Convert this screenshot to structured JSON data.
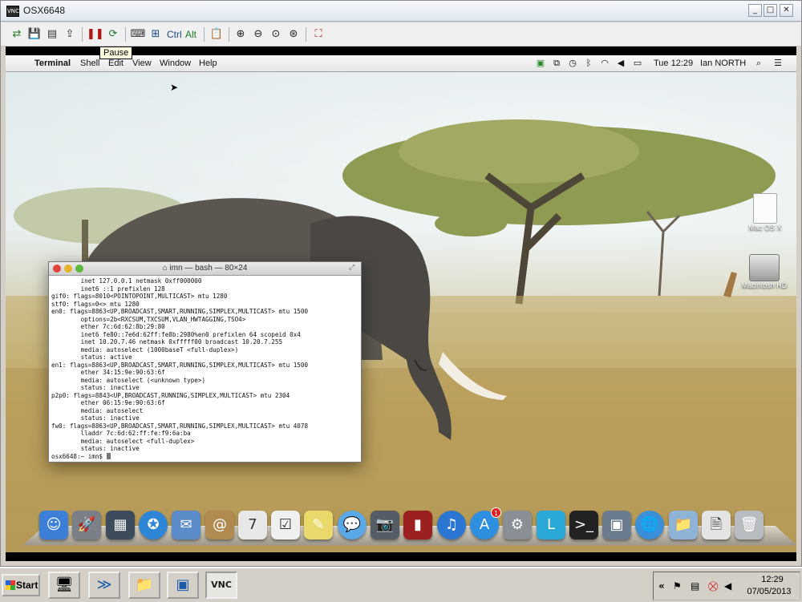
{
  "vnc": {
    "title": "OSX6648",
    "min": "_",
    "max": "□",
    "close": "✕",
    "toolbar": {
      "ctrl": "Ctrl",
      "alt": "Alt"
    },
    "tooltip": "Pause"
  },
  "mac_menubar": {
    "apple": "",
    "app": "Terminal",
    "items": [
      "Shell",
      "Edit",
      "View",
      "Window",
      "Help"
    ],
    "clock": "Tue 12:29",
    "user": "Ian NORTH",
    "spotlight": "⌕",
    "list": "☰"
  },
  "terminal": {
    "title": "⌂ imn — bash — 80×24",
    "lines": [
      "        inet 127.0.0.1 netmask 0xff000000",
      "        inet6 ::1 prefixlen 128",
      "gif0: flags=8010<POINTOPOINT,MULTICAST> mtu 1280",
      "stf0: flags=0<> mtu 1280",
      "en0: flags=8863<UP,BROADCAST,SMART,RUNNING,SIMPLEX,MULTICAST> mtu 1500",
      "        options=2b<RXCSUM,TXCSUM,VLAN_HWTAGGING,TSO4>",
      "        ether 7c:6d:62:8b:29:80",
      "        inet6 fe80::7e6d:62ff:fe8b:2980%en0 prefixlen 64 scopeid 0x4",
      "        inet 10.20.7.46 netmask 0xfffff00 broadcast 10.20.7.255",
      "        media: autoselect (1000baseT <full-duplex>)",
      "        status: active",
      "en1: flags=8863<UP,BROADCAST,SMART,RUNNING,SIMPLEX,MULTICAST> mtu 1500",
      "        ether 34:15:9e:90:63:6f",
      "        media: autoselect (<unknown type>)",
      "        status: inactive",
      "p2p0: flags=8843<UP,BROADCAST,RUNNING,SIMPLEX,MULTICAST> mtu 2304",
      "        ether 06:15:9e:90:63:6f",
      "        media: autoselect",
      "        status: inactive",
      "fw0: flags=8863<UP,BROADCAST,SMART,RUNNING,SIMPLEX,MULTICAST> mtu 4078",
      "        lladdr 7c:6d:62:ff:fe:f9:6a:ba",
      "        media: autoselect <full-duplex>",
      "        status: inactive"
    ],
    "prompt": "osx6648:~ imn$ "
  },
  "desktop": {
    "icons": [
      {
        "label": "Mac OS X",
        "glyph": "🗋"
      },
      {
        "label": "Macintosh HD",
        "glyph": "🖴"
      }
    ]
  },
  "dock": {
    "items": [
      {
        "name": "finder",
        "glyph": "☺",
        "color": "#3b7fd9"
      },
      {
        "name": "launchpad",
        "glyph": "🚀",
        "color": "#7a7f88"
      },
      {
        "name": "mission-control",
        "glyph": "▦",
        "color": "#3c4c5c"
      },
      {
        "name": "safari",
        "glyph": "✪",
        "color": "#2f86d6"
      },
      {
        "name": "mail",
        "glyph": "✉",
        "color": "#5b8bc8"
      },
      {
        "name": "contacts",
        "glyph": "@",
        "color": "#b08a4e"
      },
      {
        "name": "calendar",
        "glyph": "7",
        "color": "#e8e8e8"
      },
      {
        "name": "reminders",
        "glyph": "☑",
        "color": "#f0f0f0"
      },
      {
        "name": "notes",
        "glyph": "✎",
        "color": "#e9d96a"
      },
      {
        "name": "messages",
        "glyph": "💬",
        "color": "#5aa8e8"
      },
      {
        "name": "facetime",
        "glyph": "📷",
        "color": "#555c66"
      },
      {
        "name": "photo-booth",
        "glyph": "▮",
        "color": "#9c2020"
      },
      {
        "name": "itunes",
        "glyph": "♫",
        "color": "#2a76d2"
      },
      {
        "name": "app-store",
        "glyph": "A",
        "color": "#2e8ee0"
      },
      {
        "name": "system-preferences",
        "glyph": "⚙",
        "color": "#8a8f96"
      },
      {
        "name": "lync",
        "glyph": "L",
        "color": "#2aa8d8"
      },
      {
        "name": "terminal",
        "glyph": ">_",
        "color": "#222222"
      },
      {
        "name": "remote-desktop",
        "glyph": "▣",
        "color": "#6a7c8e"
      },
      {
        "name": "network-utility",
        "glyph": "🌐",
        "color": "#3a8fd9"
      },
      {
        "name": "documents-stack",
        "glyph": "📁",
        "color": "#8fb3d6"
      },
      {
        "name": "downloads-stack",
        "glyph": "🗎",
        "color": "#e4e4e4"
      },
      {
        "name": "trash",
        "glyph": "🗑",
        "color": "#b8bcc0"
      }
    ],
    "app_store_badge": "1"
  },
  "taskbar": {
    "start": "Start",
    "tray_chevron": "«",
    "time": "12:29",
    "date": "07/05/2013"
  }
}
